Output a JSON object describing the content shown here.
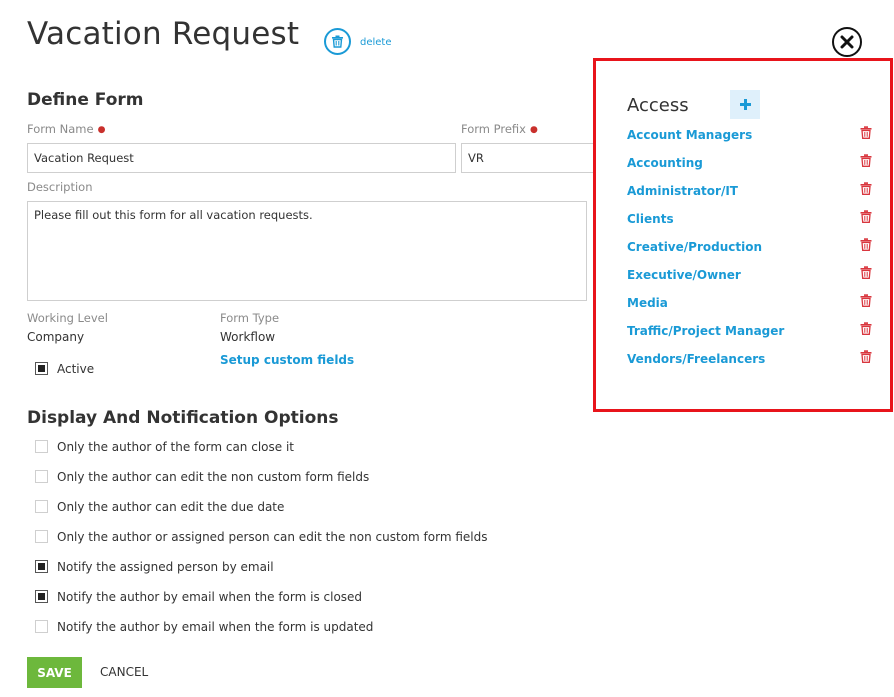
{
  "header": {
    "title": "Vacation Request",
    "delete_label": "delete",
    "close_icon": "close-icon"
  },
  "define_form": {
    "heading": "Define Form",
    "form_name_label": "Form Name",
    "form_name_value": "Vacation Request",
    "form_prefix_label": "Form Prefix",
    "form_prefix_value": "VR",
    "description_label": "Description",
    "description_value": "Please fill out this form for all vacation requests.",
    "working_level_label": "Working Level",
    "working_level_value": "Company",
    "form_type_label": "Form Type",
    "form_type_value": "Workflow",
    "custom_fields_link": "Setup custom fields",
    "active_label": "Active",
    "active_checked": true
  },
  "display_options": {
    "heading": "Display And Notification Options",
    "options": [
      {
        "label": "Only the author of the form can close it",
        "checked": false
      },
      {
        "label": "Only the author can edit the non custom form fields",
        "checked": false
      },
      {
        "label": "Only the author can edit the due date",
        "checked": false
      },
      {
        "label": "Only the author or assigned person can edit the non custom form fields",
        "checked": false
      },
      {
        "label": "Notify the assigned person by email",
        "checked": true
      },
      {
        "label": "Notify the author by email when the form is closed",
        "checked": true
      },
      {
        "label": "Notify the author by email when the form is updated",
        "checked": false
      }
    ]
  },
  "actions": {
    "save_label": "SAVE",
    "cancel_label": "CANCEL"
  },
  "access": {
    "title": "Access",
    "add_icon": "plus-icon",
    "items": [
      "Account Managers",
      "Accounting",
      "Administrator/IT",
      "Clients",
      "Creative/Production",
      "Executive/Owner",
      "Media",
      "Traffic/Project Manager",
      "Vendors/Freelancers"
    ]
  },
  "colors": {
    "accent_blue": "#1a9ad6",
    "save_green": "#6db83c",
    "highlight_red": "#e8141b",
    "remove_red": "#d9363e",
    "required_red": "#c9302c"
  }
}
